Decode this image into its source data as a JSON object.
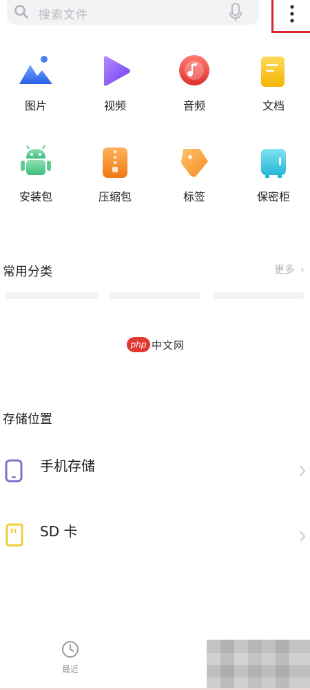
{
  "search": {
    "placeholder": "搜索文件"
  },
  "categories": [
    {
      "label": "图片",
      "icon": "image-icon"
    },
    {
      "label": "视频",
      "icon": "video-icon"
    },
    {
      "label": "音频",
      "icon": "audio-icon"
    },
    {
      "label": "文档",
      "icon": "document-icon"
    },
    {
      "label": "安装包",
      "icon": "android-icon"
    },
    {
      "label": "压缩包",
      "icon": "zip-icon"
    },
    {
      "label": "标签",
      "icon": "tag-icon"
    },
    {
      "label": "保密柜",
      "icon": "safe-icon"
    }
  ],
  "common": {
    "title": "常用分类",
    "more": "更多"
  },
  "watermark": {
    "badge": "php",
    "text": "中文网"
  },
  "storage": {
    "title": "存储位置",
    "items": [
      {
        "label": "手机存储",
        "icon": "phone-icon"
      },
      {
        "label": "SD 卡",
        "icon": "sd-card-icon"
      }
    ]
  },
  "bottom_nav": {
    "recent": "最近"
  },
  "colors": {
    "highlight": "#d6262b",
    "placeholder": "#b9b9bf",
    "phone_icon": "#7a74c9",
    "sd_icon": "#f0cf3b"
  }
}
